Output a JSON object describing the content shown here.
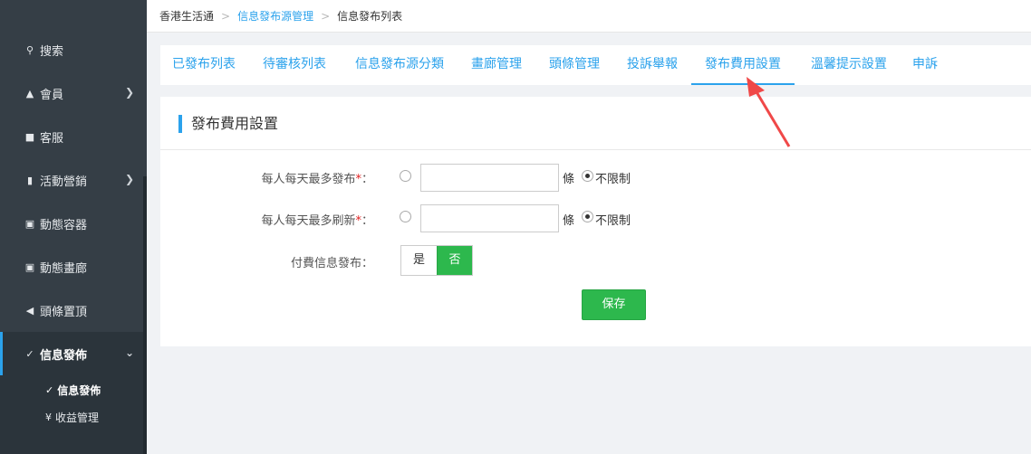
{
  "breadcrumb": {
    "home": "香港生活通",
    "section": "信息發布源管理",
    "current": "信息發布列表"
  },
  "sidebar": {
    "items": [
      {
        "label": "搜索",
        "icon": "search-icon",
        "has_arrow": false
      },
      {
        "label": "會員",
        "icon": "bell-icon",
        "has_arrow": true
      },
      {
        "label": "客服",
        "icon": "chat-icon",
        "has_arrow": false
      },
      {
        "label": "活動營銷",
        "icon": "bookmark-icon",
        "has_arrow": true
      },
      {
        "label": "動態容器",
        "icon": "box-icon",
        "has_arrow": false
      },
      {
        "label": "動態畫廊",
        "icon": "image-icon",
        "has_arrow": false
      },
      {
        "label": "頭條置頂",
        "icon": "megaphone-icon",
        "has_arrow": false
      },
      {
        "label": "信息發佈",
        "icon": "edit-icon",
        "has_arrow": true,
        "active": true
      }
    ],
    "submenu": [
      {
        "label": "信息發佈",
        "icon": "edit-icon",
        "current": true
      },
      {
        "label": "收益管理",
        "icon": "yen-icon",
        "current": false
      }
    ]
  },
  "tabs": [
    {
      "label": "已發布列表"
    },
    {
      "label": "待審核列表"
    },
    {
      "label": "信息發布源分類"
    },
    {
      "label": "畫廊管理"
    },
    {
      "label": "頭條管理"
    },
    {
      "label": "投訴舉報"
    },
    {
      "label": "發布費用設置",
      "active": true
    },
    {
      "label": "溫馨提示設置"
    },
    {
      "label": "申訴"
    }
  ],
  "form": {
    "title": "發布費用設置",
    "rows": [
      {
        "label": "每人每天最多發布",
        "required_mark": "*",
        "colon": "：",
        "value": "",
        "unit": "條",
        "unlimited_label": "不限制",
        "unlimited_checked": true
      },
      {
        "label": "每人每天最多刷新",
        "required_mark": "*",
        "colon": "：",
        "value": "",
        "unit": "條",
        "unlimited_label": "不限制",
        "unlimited_checked": true
      }
    ],
    "paid": {
      "label": "付費信息發布：",
      "options": [
        "是",
        "否"
      ],
      "selected": "否"
    },
    "save_label": "保存"
  },
  "colors": {
    "accent": "#2ba2ec",
    "success": "#2db84d",
    "sidebar_bg": "#353e46",
    "annotation_arrow": "#f04848"
  }
}
